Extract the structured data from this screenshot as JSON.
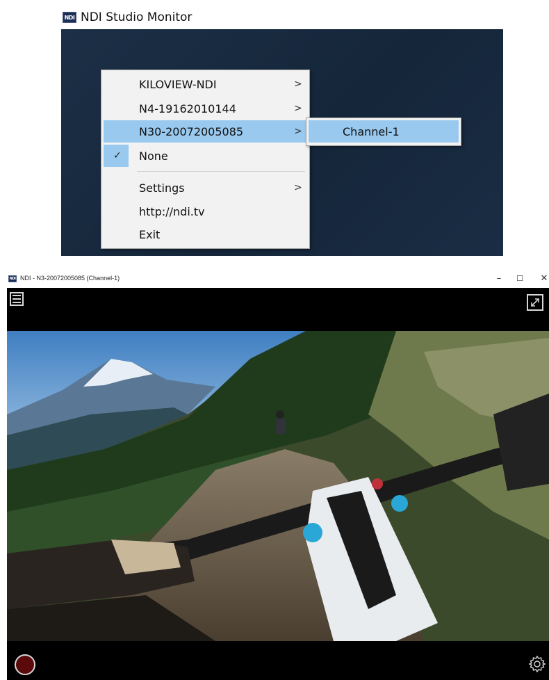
{
  "top_window": {
    "title": "NDI Studio Monitor",
    "logo_text": "NDI"
  },
  "context_menu": {
    "items": [
      {
        "label": "KILOVIEW-NDI",
        "has_submenu": true
      },
      {
        "label": "N4-19162010144",
        "has_submenu": true
      },
      {
        "label": "N30-20072005085",
        "has_submenu": true,
        "highlighted": true
      },
      {
        "label": "None",
        "checked": true
      },
      {
        "label": "Settings",
        "has_submenu": true
      },
      {
        "label": "http://ndi.tv"
      },
      {
        "label": "Exit"
      }
    ],
    "submenu": {
      "label": "Channel-1"
    },
    "arrow_glyph": ">",
    "check_glyph": "✓",
    "highlight_color": "#99c9ef"
  },
  "bottom_window": {
    "title": "NDI - N3-20072005085 (Channel-1)",
    "logo_text": "NDI",
    "controls": {
      "minimize": "–",
      "maximize": "☐",
      "close": "✕"
    },
    "icons": [
      "hamburger-menu-icon",
      "fullscreen-icon",
      "record-icon",
      "gear-icon"
    ],
    "record_color": "#5a0a0a"
  }
}
